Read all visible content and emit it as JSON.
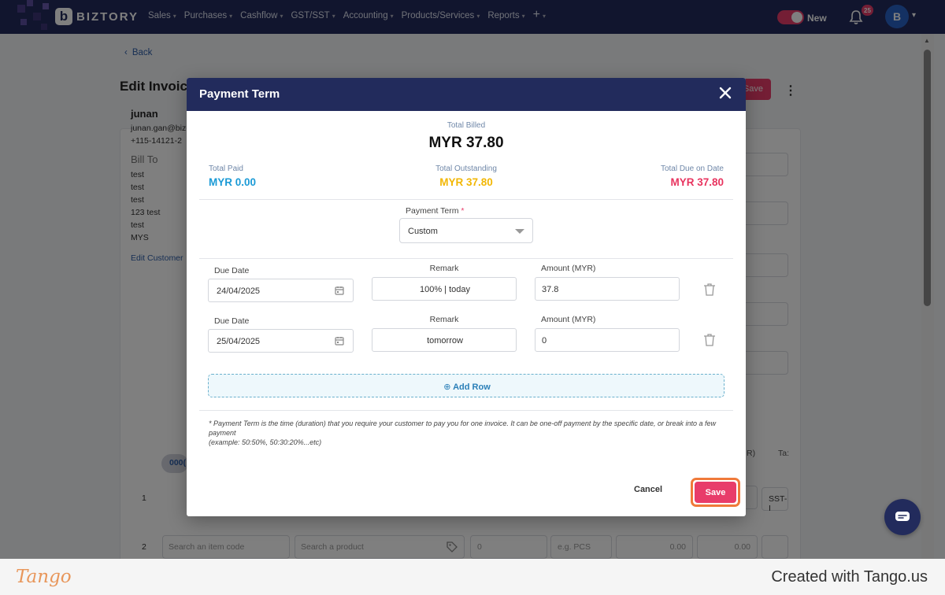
{
  "app": {
    "brand": "BIZTORY",
    "nav": [
      "Sales",
      "Purchases",
      "Cashflow",
      "GST/SST",
      "Accounting",
      "Products/Services",
      "Reports"
    ],
    "toggle_label": "New",
    "notification_count": "25",
    "avatar_initial": "B"
  },
  "page": {
    "back_label": "Back",
    "title": "Edit Invoice",
    "save_label": "Save",
    "customer": {
      "name": "junan",
      "email": "junan.gan@biz",
      "phone": "+115-14121-2",
      "bill_to_label": "Bill To",
      "address_lines": [
        "test",
        "test",
        "test",
        "123 test",
        "test",
        "MYS"
      ],
      "edit_label": "Edit Customer"
    },
    "items": {
      "row1_index": "1",
      "row1_chip": "000(",
      "row2_index": "2",
      "item_code_placeholder": "Search an item code",
      "product_placeholder": "Search a product",
      "qty_value": "0",
      "unit_placeholder": "e.g. PCS",
      "price_value": "0.00",
      "discount_value": "0.00",
      "tax_label": "SST-I",
      "col_frag_1": "R)",
      "col_frag_2": "Ta:"
    }
  },
  "modal": {
    "title": "Payment Term",
    "total_billed_label": "Total Billed",
    "total_billed_value": "MYR 37.80",
    "total_paid_label": "Total Paid",
    "total_paid_value": "MYR 0.00",
    "total_outstanding_label": "Total Outstanding",
    "total_outstanding_value": "MYR 37.80",
    "total_due_label": "Total Due on Date",
    "total_due_value": "MYR 37.80",
    "payment_term_label": "Payment Term",
    "payment_term_value": "Custom",
    "columns": {
      "due_date": "Due Date",
      "remark": "Remark",
      "amount": "Amount (MYR)"
    },
    "rows": [
      {
        "due_date": "24/04/2025",
        "remark": "100% |  today",
        "amount": "37.8"
      },
      {
        "due_date": "25/04/2025",
        "remark": "tomorrow",
        "amount": "0"
      }
    ],
    "add_row_label": "Add Row",
    "note_line1": "* Payment Term is the time (duration) that you require your customer to pay you for one invoice. It can be one-off payment by the specific date, or break into a few payment",
    "note_line2": "(example: 50:50%, 50:30:20%...etc)",
    "cancel_label": "Cancel",
    "save_label": "Save"
  },
  "colors": {
    "navy": "#222b5c",
    "paid_blue": "#1a9ad6",
    "outstanding_yellow": "#f2b705",
    "due_red": "#e8345f",
    "accent_pink": "#e83c6a",
    "highlight_orange": "#f07a3a"
  },
  "footer": {
    "logo": "Tango",
    "credit": "Created with Tango.us"
  }
}
